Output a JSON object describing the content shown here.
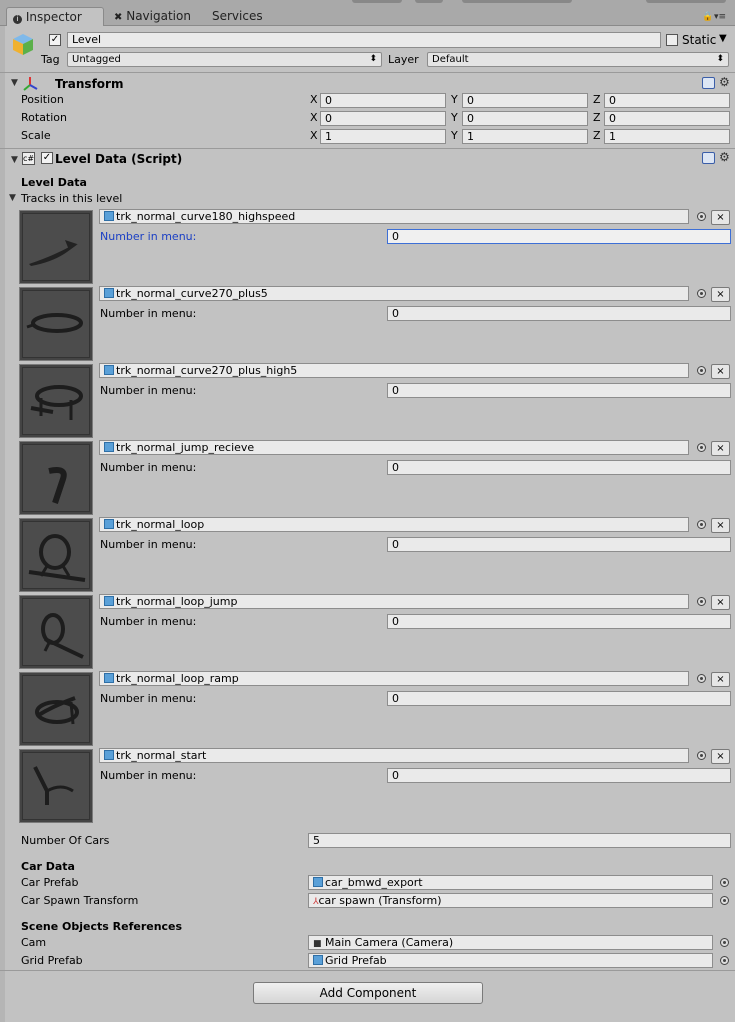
{
  "tabs": [
    {
      "label": "Inspector",
      "icon": "info-icon"
    },
    {
      "label": "Navigation",
      "icon": "navigation-icon"
    },
    {
      "label": "Services"
    }
  ],
  "object": {
    "name": "Level",
    "static_label": "Static",
    "tag_label": "Tag",
    "tag_value": "Untagged",
    "layer_label": "Layer",
    "layer_value": "Default"
  },
  "transform": {
    "title": "Transform",
    "rows": [
      {
        "label": "Position",
        "x": "0",
        "y": "0",
        "z": "0"
      },
      {
        "label": "Rotation",
        "x": "0",
        "y": "0",
        "z": "0"
      },
      {
        "label": "Scale",
        "x": "1",
        "y": "1",
        "z": "1"
      }
    ],
    "axis": {
      "x": "X",
      "y": "Y",
      "z": "Z"
    }
  },
  "script": {
    "title": "Level Data (Script)",
    "section": "Level Data",
    "tracks_label": "Tracks in this level",
    "number_label": "Number in menu:",
    "tracks": [
      {
        "name": "trk_normal_curve180_highspeed",
        "number": "0"
      },
      {
        "name": "trk_normal_curve270_plus5",
        "number": "0"
      },
      {
        "name": "trk_normal_curve270_plus_high5",
        "number": "0"
      },
      {
        "name": "trk_normal_jump_recieve",
        "number": "0"
      },
      {
        "name": "trk_normal_loop",
        "number": "0"
      },
      {
        "name": "trk_normal_loop_jump",
        "number": "0"
      },
      {
        "name": "trk_normal_loop_ramp",
        "number": "0"
      },
      {
        "name": "trk_normal_start",
        "number": "0"
      }
    ],
    "remove_symbol": "×",
    "number_of_cars_label": "Number Of Cars",
    "number_of_cars_value": "5",
    "car_data_heading": "Car Data",
    "car_prefab_label": "Car Prefab",
    "car_prefab_value": "car_bmwd_export",
    "car_spawn_label": "Car Spawn Transform",
    "car_spawn_value": "car spawn (Transform)",
    "scene_heading": "Scene Objects References",
    "cam_label": "Cam",
    "cam_value": "Main Camera (Camera)",
    "grid_label": "Grid Prefab",
    "grid_value": "Grid Prefab"
  },
  "add_component_label": "Add Component",
  "colors": {
    "focus": "#3d6fd6",
    "label_active": "#1a3fc4"
  }
}
